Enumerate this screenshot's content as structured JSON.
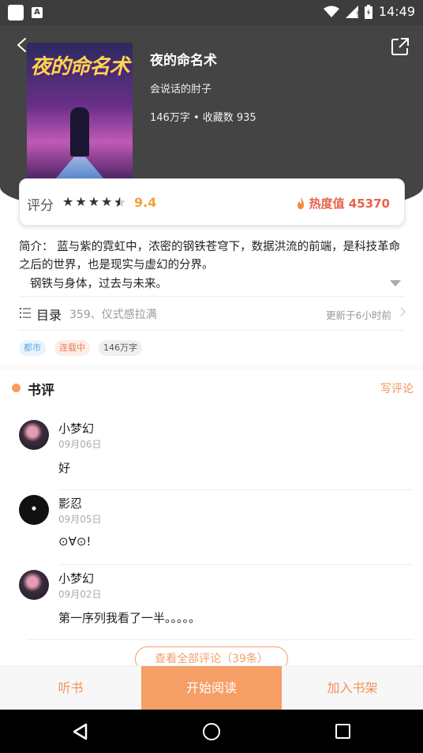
{
  "status_bar": {
    "time": "14:49",
    "notif_icon": "A"
  },
  "book": {
    "title": "夜的命名术",
    "author": "会说话的肘子",
    "stats": "146万字 • 收藏数 935",
    "cover_text": "夜的命名术"
  },
  "rating": {
    "label": "评分",
    "stars": 4.5,
    "score": "9.4",
    "heat": "热度值 45370"
  },
  "intro": {
    "line1": "简介：     蓝与紫的霓虹中，浓密的钢铁苍穹下，数据洪流的前端，是科技革命之后的世界，也是现实与虚幻的分界。",
    "line2": "钢铁与身体，过去与未来。"
  },
  "toc": {
    "label": "目录",
    "latest": "359、仪式感拉满",
    "updated": "更新于6小时前"
  },
  "tags": [
    "都市",
    "连载中",
    "146万字"
  ],
  "reviews_section": {
    "title": "书评",
    "write_label": "写评论",
    "view_all": "查看全部评论（39条）",
    "items": [
      {
        "name": "小梦幻",
        "date": "09月06日",
        "text": "好"
      },
      {
        "name": "影忍",
        "date": "09月05日",
        "text": "⊙∀⊙!"
      },
      {
        "name": "小梦幻",
        "date": "09月02日",
        "text": "第一序列我看了一半。。。。。"
      }
    ]
  },
  "actions": {
    "listen": "听书",
    "read": "开始阅读",
    "shelf": "加入书架"
  },
  "colors": {
    "accent": "#f59e66",
    "header_bg": "#444444",
    "score": "#f1a13c",
    "heat": "#e8634a"
  }
}
